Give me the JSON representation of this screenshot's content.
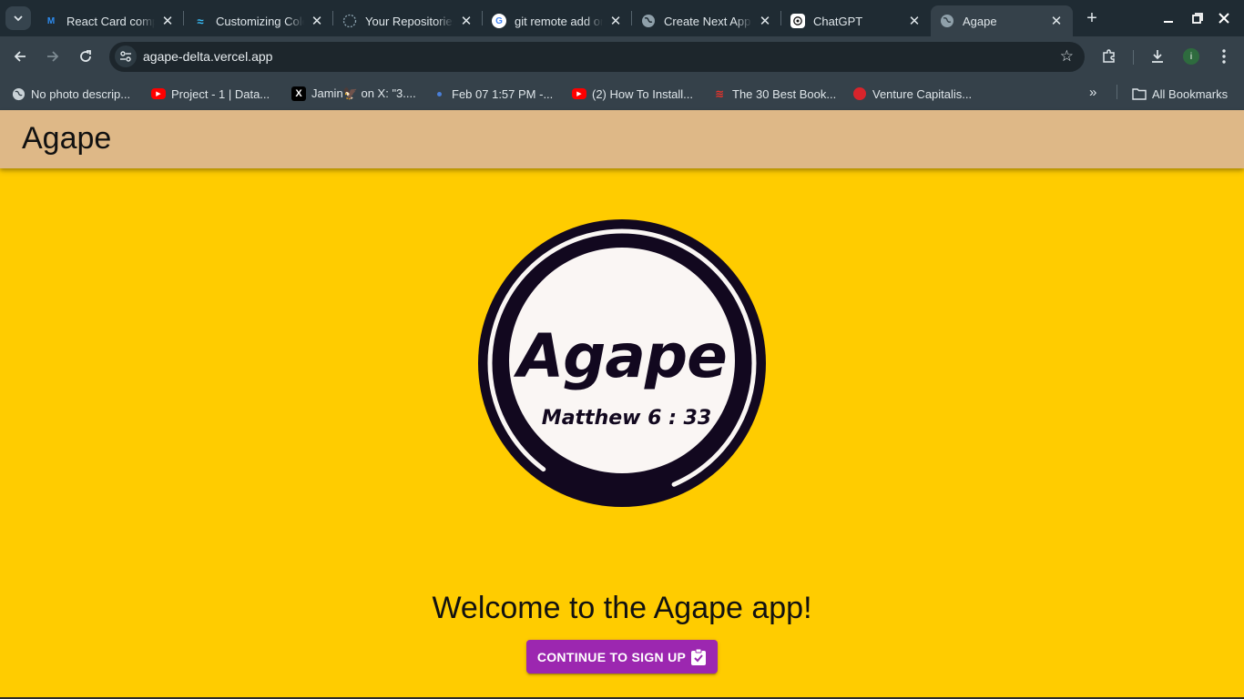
{
  "browser": {
    "tabs": [
      {
        "label": "React Card component",
        "favicon": "mui-icon",
        "active": false
      },
      {
        "label": "Customizing Colors",
        "favicon": "tailwind-icon",
        "active": false
      },
      {
        "label": "Your Repositories",
        "favicon": "loading-icon",
        "active": false
      },
      {
        "label": "git remote add origin",
        "favicon": "google-icon",
        "active": false
      },
      {
        "label": "Create Next App",
        "favicon": "globe-icon",
        "active": false
      },
      {
        "label": "ChatGPT",
        "favicon": "chatgpt-icon",
        "active": false
      },
      {
        "label": "Agape",
        "favicon": "globe-icon",
        "active": true
      }
    ],
    "url": "agape-delta.vercel.app",
    "profile_initial": "i",
    "bookmarks": [
      {
        "label": "No photo descrip...",
        "icon": "globe-icon"
      },
      {
        "label": "Project - 1 | Data...",
        "icon": "youtube-icon"
      },
      {
        "label": "Jamin🦅 on X: \"3....",
        "icon": "x-icon"
      },
      {
        "label": "Feb 07 1:57 PM -...",
        "icon": "dot-icon"
      },
      {
        "label": "(2) How To Install...",
        "icon": "youtube-icon"
      },
      {
        "label": "The 30 Best Book...",
        "icon": "bird-icon"
      },
      {
        "label": "Venture Capitalis...",
        "icon": "venture-icon"
      }
    ],
    "all_bookmarks_label": "All Bookmarks"
  },
  "app": {
    "title": "Agape",
    "logo_text": "Agape",
    "logo_verse": "Matthew 6 : 33",
    "welcome": "Welcome to the Agape app!",
    "cta_label": "CONTINUE TO SIGN UP"
  },
  "colors": {
    "background": "#ffcc00",
    "app_bar": "#deb887",
    "cta": "#9c27b0",
    "logo_dark": "#12081f",
    "logo_light": "#faf6f4"
  }
}
